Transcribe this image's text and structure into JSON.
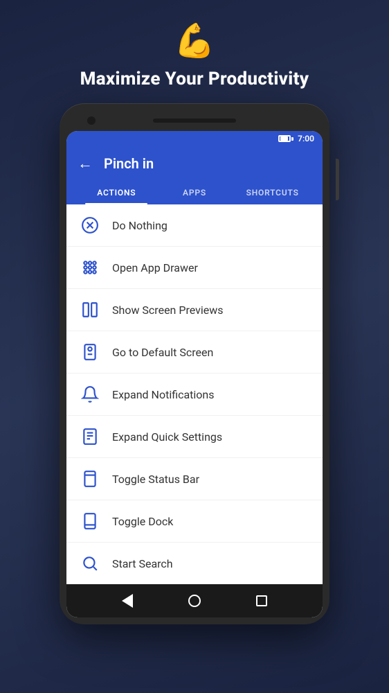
{
  "header": {
    "emoji": "💪",
    "title": "Maximize Your Productivity"
  },
  "status_bar": {
    "time": "7:00"
  },
  "toolbar": {
    "back_label": "←",
    "title": "Pinch in",
    "tabs": [
      {
        "label": "ACTIONS",
        "active": true
      },
      {
        "label": "APPS",
        "active": false
      },
      {
        "label": "SHORTCUTS",
        "active": false
      }
    ]
  },
  "actions": [
    {
      "id": "do-nothing",
      "label": "Do Nothing",
      "icon": "x-circle"
    },
    {
      "id": "open-app-drawer",
      "label": "Open App Drawer",
      "icon": "grid"
    },
    {
      "id": "show-screen-previews",
      "label": "Show Screen Previews",
      "icon": "screen-preview"
    },
    {
      "id": "go-to-default-screen",
      "label": "Go to Default Screen",
      "icon": "home"
    },
    {
      "id": "expand-notifications",
      "label": "Expand Notifications",
      "icon": "bell"
    },
    {
      "id": "expand-quick-settings",
      "label": "Expand Quick Settings",
      "icon": "quick-settings"
    },
    {
      "id": "toggle-status-bar",
      "label": "Toggle Status Bar",
      "icon": "phone-top"
    },
    {
      "id": "toggle-dock",
      "label": "Toggle Dock",
      "icon": "dock"
    },
    {
      "id": "start-search",
      "label": "Start Search",
      "icon": "search"
    }
  ],
  "nav": {
    "back": "back",
    "home": "home",
    "recents": "recents"
  }
}
